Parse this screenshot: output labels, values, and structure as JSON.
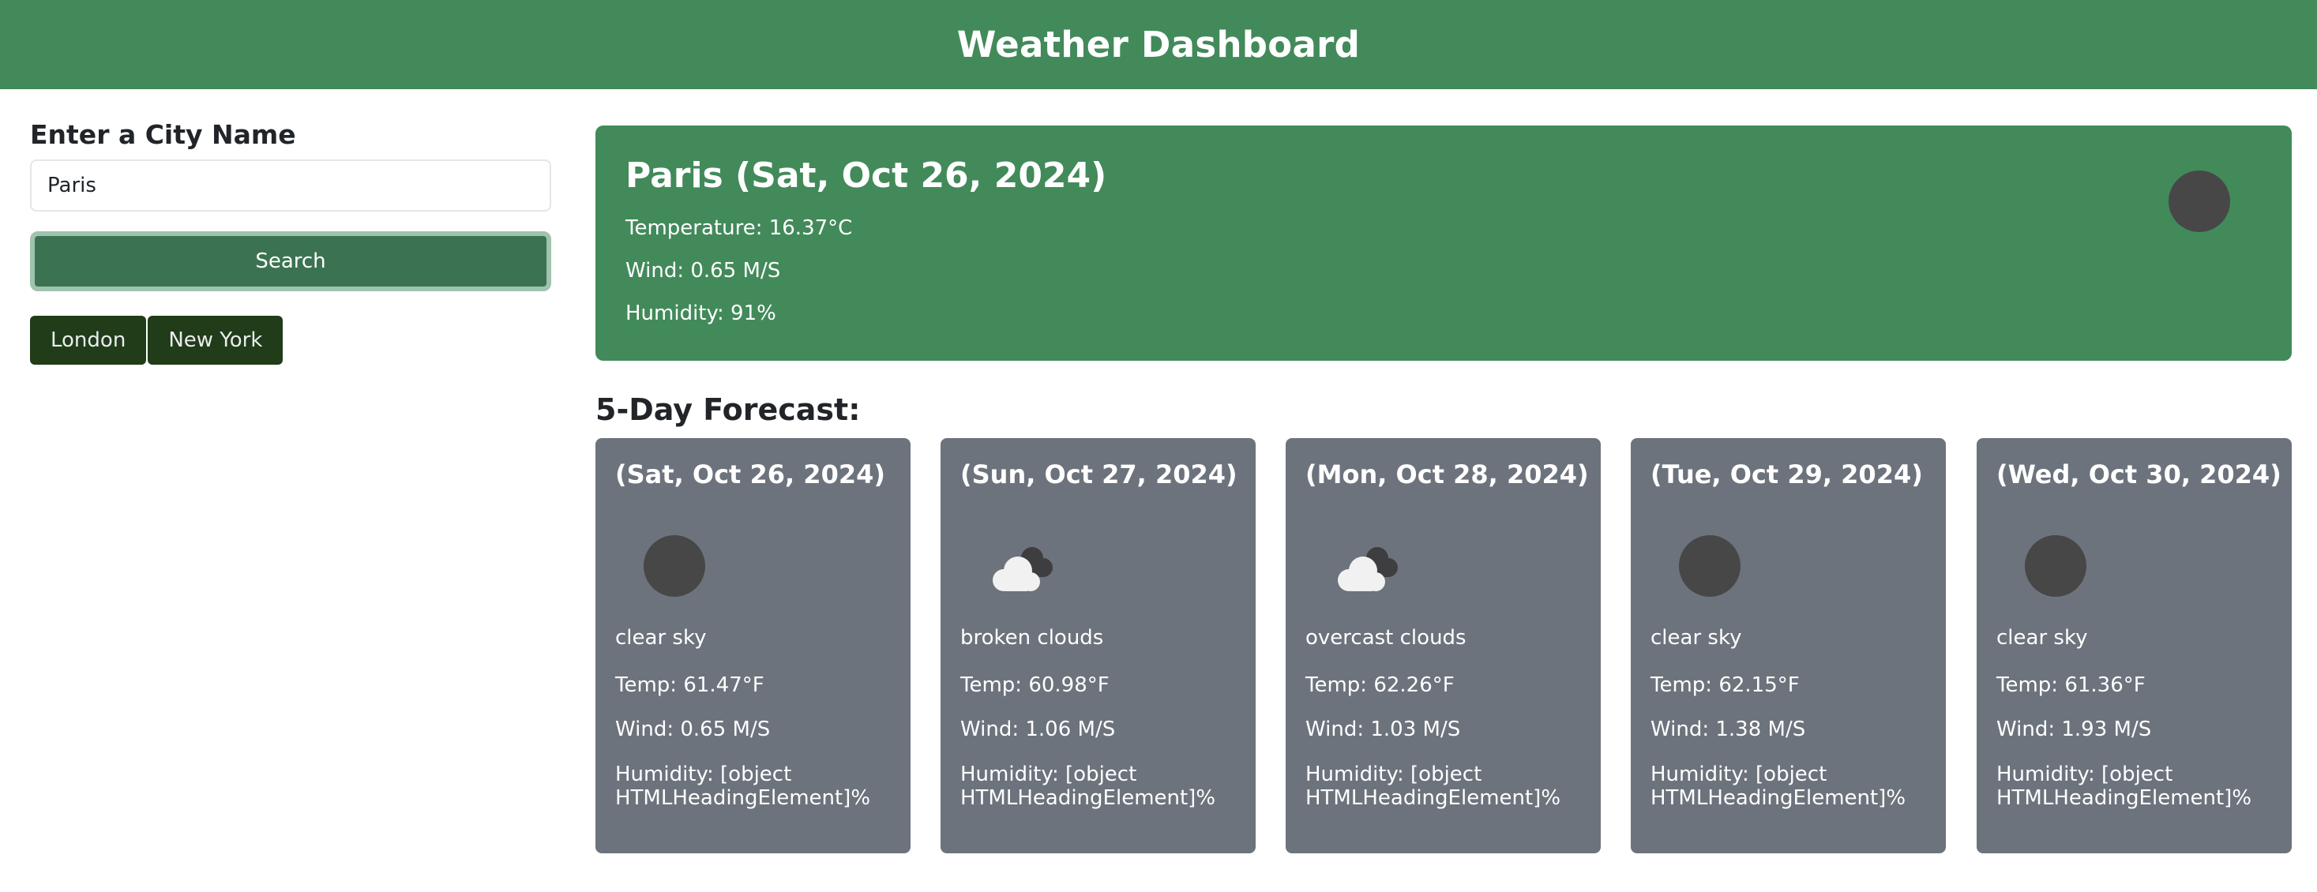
{
  "header": {
    "title": "Weather Dashboard"
  },
  "sidebar": {
    "heading": "Enter a City Name",
    "search_value": "Paris",
    "search_button": "Search",
    "history": [
      "London",
      "New York"
    ]
  },
  "current": {
    "title": "Paris (Sat, Oct 26, 2024)",
    "temperature": "Temperature: 16.37°C",
    "wind": "Wind: 0.65 M/S",
    "humidity": "Humidity: 91%",
    "icon": "clear-sky-icon"
  },
  "forecast": {
    "title": "5-Day Forecast:",
    "days": [
      {
        "date": "(Sat, Oct 26, 2024)",
        "icon": "clear-sky-icon",
        "desc": "clear sky",
        "temp": "Temp: 61.47°F",
        "wind": "Wind: 0.65 M/S",
        "humidity": "Humidity: [object HTMLHeadingElement]%"
      },
      {
        "date": "(Sun, Oct 27, 2024)",
        "icon": "broken-clouds-icon",
        "desc": "broken clouds",
        "temp": "Temp: 60.98°F",
        "wind": "Wind: 1.06 M/S",
        "humidity": "Humidity: [object HTMLHeadingElement]%"
      },
      {
        "date": "(Mon, Oct 28, 2024)",
        "icon": "overcast-clouds-icon",
        "desc": "overcast clouds",
        "temp": "Temp: 62.26°F",
        "wind": "Wind: 1.03 M/S",
        "humidity": "Humidity: [object HTMLHeadingElement]%"
      },
      {
        "date": "(Tue, Oct 29, 2024)",
        "icon": "clear-sky-icon",
        "desc": "clear sky",
        "temp": "Temp: 62.15°F",
        "wind": "Wind: 1.38 M/S",
        "humidity": "Humidity: [object HTMLHeadingElement]%"
      },
      {
        "date": "(Wed, Oct 30, 2024)",
        "icon": "clear-sky-icon",
        "desc": "clear sky",
        "temp": "Temp: 61.36°F",
        "wind": "Wind: 1.93 M/S",
        "humidity": "Humidity: [object HTMLHeadingElement]%"
      }
    ]
  },
  "colors": {
    "header_bg": "#428a5a",
    "current_bg": "#428a5a",
    "search_button_bg": "#3b7352",
    "history_button_bg": "#213c18",
    "card_bg": "#6c737c"
  }
}
